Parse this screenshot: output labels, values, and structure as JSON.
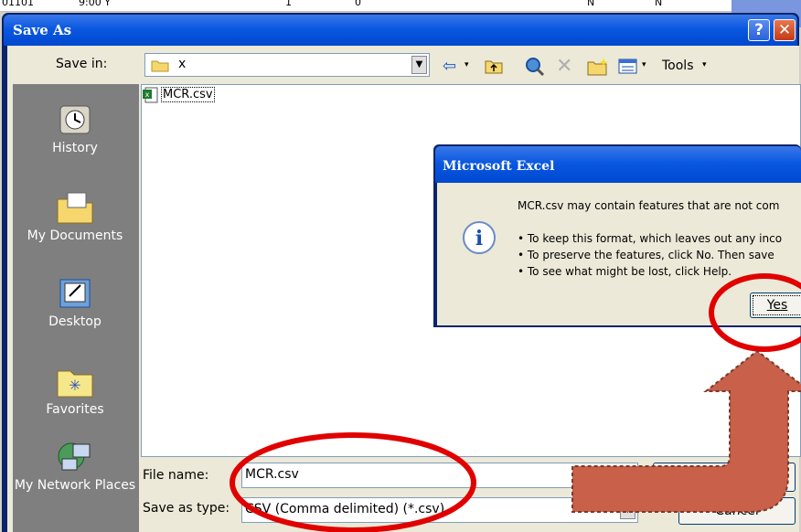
{
  "background_sheet": {
    "cells": [
      "01101",
      "9:00 Y",
      "1",
      "0",
      "N",
      "N"
    ]
  },
  "dialog": {
    "title": "Save As",
    "save_in_label": "Save in:",
    "save_in_value": "x",
    "tools_label": "Tools",
    "places": [
      {
        "label": "History",
        "icon": "history-icon"
      },
      {
        "label": "My Documents",
        "icon": "my-documents-icon"
      },
      {
        "label": "Desktop",
        "icon": "desktop-icon"
      },
      {
        "label": "Favorites",
        "icon": "favorites-icon"
      },
      {
        "label": "My Network Places",
        "icon": "network-places-icon"
      }
    ],
    "files": [
      {
        "name": "MCR.csv",
        "icon": "csv-file-icon"
      }
    ],
    "file_name_label": "File name:",
    "file_name_value": "MCR.csv",
    "save_type_label": "Save as type:",
    "save_type_value": "CSV (Comma delimited) (*.csv)",
    "cancel_label": "Cancel"
  },
  "message_box": {
    "title": "Microsoft Excel",
    "icon": "info-icon",
    "line1": "MCR.csv may contain features that are not com",
    "line2": "• To keep this format, which leaves out any inco",
    "line3": "• To preserve the features, click No. Then save",
    "line4": "• To see what might be lost, click Help.",
    "yes_label": "Yes"
  },
  "annotation": {
    "circle_color": "#e00000",
    "arrow_color": "#c8604a"
  }
}
